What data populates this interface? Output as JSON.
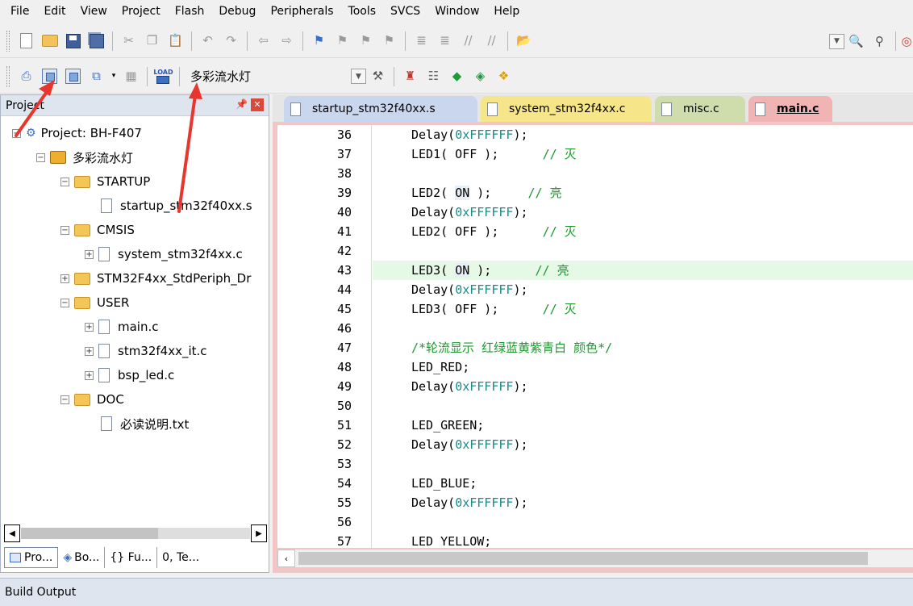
{
  "menu": [
    "File",
    "Edit",
    "View",
    "Project",
    "Flash",
    "Debug",
    "Peripherals",
    "Tools",
    "SVCS",
    "Window",
    "Help"
  ],
  "toolbar2": {
    "load_icon_text": "LOAD",
    "target_name": "多彩流水灯"
  },
  "project_panel": {
    "title": "Project",
    "tree": {
      "project": "Project: BH-F407",
      "target": "多彩流水灯",
      "groups": [
        {
          "name": "STARTUP",
          "files": [
            "startup_stm32f40xx.s"
          ]
        },
        {
          "name": "CMSIS",
          "files": [
            "system_stm32f4xx.c"
          ]
        },
        {
          "name": "STM32F4xx_StdPeriph_Dr",
          "files": []
        },
        {
          "name": "USER",
          "files": [
            "main.c",
            "stm32f4xx_it.c",
            "bsp_led.c"
          ]
        },
        {
          "name": "DOC",
          "files": [
            "必读说明.txt"
          ]
        }
      ]
    },
    "tabs": [
      "Pro...",
      "Bo...",
      "{} Fu...",
      "0, Te..."
    ]
  },
  "editor": {
    "tabs": [
      {
        "label": "startup_stm32f40xx.s",
        "color": "#c9d6ee"
      },
      {
        "label": "system_stm32f4xx.c",
        "color": "#f7e58a"
      },
      {
        "label": "misc.c",
        "color": "#cfdcab"
      },
      {
        "label": "main.c",
        "color": "#f0b4b4",
        "active": true
      }
    ],
    "lines": [
      {
        "n": "36",
        "segs": [
          [
            "Delay(",
            "kw"
          ],
          [
            "0xFFFFFF",
            "hex"
          ],
          [
            ");",
            "kw"
          ]
        ]
      },
      {
        "n": "37",
        "segs": [
          [
            "LED1( OFF );      ",
            "kw"
          ],
          [
            "// 灭",
            "cm"
          ]
        ]
      },
      {
        "n": "38",
        "segs": []
      },
      {
        "n": "39",
        "segs": [
          [
            "LED2( ",
            "kw"
          ],
          [
            "ON",
            "on"
          ],
          [
            " );     ",
            "kw"
          ],
          [
            "// 亮",
            "cm"
          ]
        ]
      },
      {
        "n": "40",
        "segs": [
          [
            "Delay(",
            "kw"
          ],
          [
            "0xFFFFFF",
            "hex"
          ],
          [
            ");",
            "kw"
          ]
        ]
      },
      {
        "n": "41",
        "segs": [
          [
            "LED2( OFF );      ",
            "kw"
          ],
          [
            "// 灭",
            "cm"
          ]
        ]
      },
      {
        "n": "42",
        "segs": []
      },
      {
        "n": "43",
        "segs": [
          [
            "LED3( ",
            "kw"
          ],
          [
            "ON",
            "on"
          ],
          [
            " );      ",
            "kw"
          ],
          [
            "// 亮",
            "cm"
          ]
        ],
        "highlight": true
      },
      {
        "n": "44",
        "segs": [
          [
            "Delay(",
            "kw"
          ],
          [
            "0xFFFFFF",
            "hex"
          ],
          [
            ");",
            "kw"
          ]
        ]
      },
      {
        "n": "45",
        "segs": [
          [
            "LED3( OFF );      ",
            "kw"
          ],
          [
            "// 灭",
            "cm"
          ]
        ]
      },
      {
        "n": "46",
        "segs": []
      },
      {
        "n": "47",
        "segs": [
          [
            "/*轮流显示 红绿蓝黄紫青白 颜色*/",
            "cm"
          ]
        ]
      },
      {
        "n": "48",
        "segs": [
          [
            "LED_RED;",
            "kw"
          ]
        ]
      },
      {
        "n": "49",
        "segs": [
          [
            "Delay(",
            "kw"
          ],
          [
            "0xFFFFFF",
            "hex"
          ],
          [
            ");",
            "kw"
          ]
        ]
      },
      {
        "n": "50",
        "segs": []
      },
      {
        "n": "51",
        "segs": [
          [
            "LED_GREEN;",
            "kw"
          ]
        ]
      },
      {
        "n": "52",
        "segs": [
          [
            "Delay(",
            "kw"
          ],
          [
            "0xFFFFFF",
            "hex"
          ],
          [
            ");",
            "kw"
          ]
        ]
      },
      {
        "n": "53",
        "segs": []
      },
      {
        "n": "54",
        "segs": [
          [
            "LED_BLUE;",
            "kw"
          ]
        ]
      },
      {
        "n": "55",
        "segs": [
          [
            "Delay(",
            "kw"
          ],
          [
            "0xFFFFFF",
            "hex"
          ],
          [
            ");",
            "kw"
          ]
        ]
      },
      {
        "n": "56",
        "segs": []
      },
      {
        "n": "57",
        "segs": [
          [
            "LED_YELLOW;",
            "kw"
          ]
        ]
      }
    ]
  },
  "build_output": {
    "title": "Build Output"
  },
  "colors": {
    "annotation": "#e8352d",
    "highlight_line": "#e6f9e6",
    "comment": "#1b9a2e",
    "hex_literal": "#1a8a8a"
  }
}
